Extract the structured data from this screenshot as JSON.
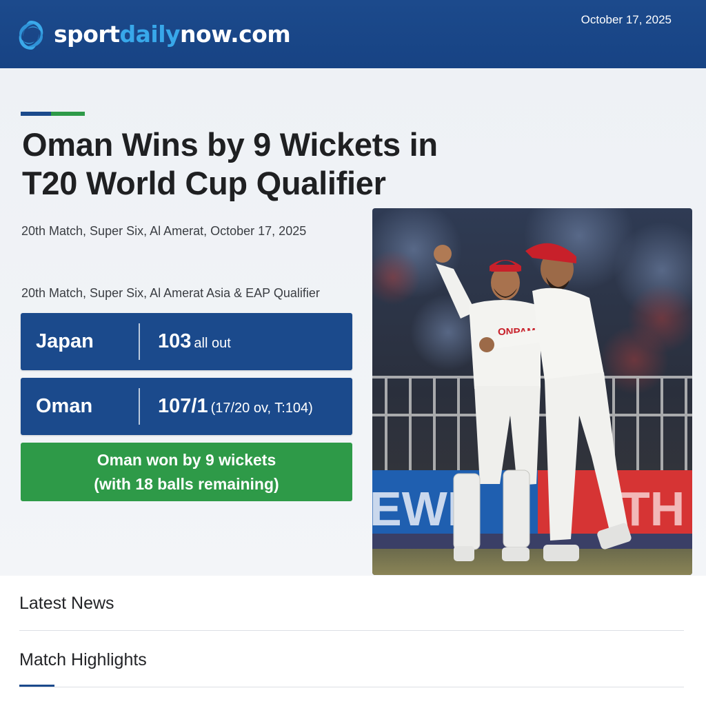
{
  "header": {
    "logo": {
      "part1": "sport",
      "part2": "daily",
      "part3": "now.com",
      "icon": "swirl-logo-icon"
    },
    "date": "October 17, 2025"
  },
  "article": {
    "headline_line1": "Oman Wins by 9 Wickets in",
    "headline_line2": "T20 World Cup Qualifier",
    "dateline": "20th Match, Super Six, Al Amerat, October 17, 2025",
    "subline": "20th Match, Super Six, Al Amerat Asia & EAP Qualifier"
  },
  "scores": [
    {
      "team": "Japan",
      "score": "103",
      "detail": "all out"
    },
    {
      "team": "Oman",
      "score": "107/1",
      "detail": "(17/20 ov, T:104)"
    }
  ],
  "result": {
    "line1": "Oman won by 9 wickets",
    "line2": "(with 18 balls remaining)"
  },
  "photo": {
    "banner_left": "EWI",
    "banner_right": "TH",
    "shirt_text": "ONPAM"
  },
  "sections": [
    {
      "title": "Latest News"
    },
    {
      "title": "Match Highlights"
    }
  ],
  "colors": {
    "header_blue": "#1c4a8c",
    "accent_blue": "#38a8ea",
    "score_blue": "#1b4a8c",
    "result_green": "#2e9a48",
    "cap_red": "#c8202a"
  }
}
